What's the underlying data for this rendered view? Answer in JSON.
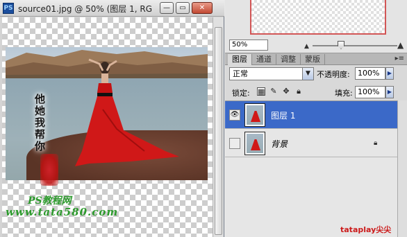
{
  "document": {
    "title": "source01.jpg @ 50% (图层 1, RG...",
    "app_icon": "PS",
    "minimize_label": "—",
    "restore_label": "▭",
    "close_label": "✕"
  },
  "artwork": {
    "calligraphy_lines": [
      "他",
      "她",
      "我",
      "帮",
      "你"
    ],
    "watermark_line1": "PS教程网",
    "watermark_line2": "www.tata580.com"
  },
  "navigator": {
    "zoom_value": "50%",
    "zoom_out_icon": "small-mountain-icon",
    "zoom_in_icon": "large-mountain-icon",
    "zoom_slider_level": 0.3
  },
  "layers_panel": {
    "tabs": [
      {
        "label": "图层",
        "active": true
      },
      {
        "label": "通道",
        "active": false
      },
      {
        "label": "调整",
        "active": false
      },
      {
        "label": "蒙版",
        "active": false
      }
    ],
    "blend_mode": "正常",
    "opacity_label": "不透明度:",
    "opacity_value": "100%",
    "lock_label": "锁定:",
    "fill_label": "填充:",
    "fill_value": "100%",
    "layers": [
      {
        "name": "图层 1",
        "selected": true,
        "visible": true,
        "locked": false
      },
      {
        "name": "背景",
        "selected": false,
        "visible": false,
        "locked": true
      }
    ]
  },
  "brand": "tataplay尖尖",
  "colors": {
    "selection": "#3b69c8",
    "dress": "#d01818",
    "watermark": "#2d9a2d",
    "brand": "#cc1a1a"
  }
}
